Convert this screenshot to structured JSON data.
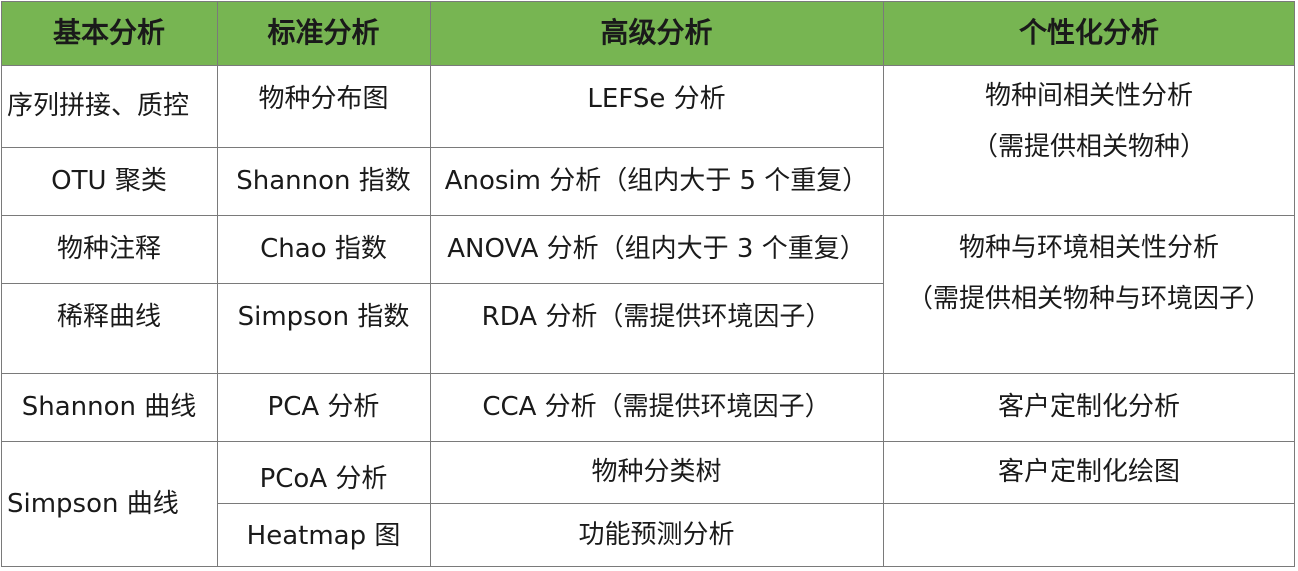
{
  "headers": [
    "基本分析",
    "标准分析",
    "高级分析",
    "个性化分析"
  ],
  "basic": [
    "序列拼接、质控",
    "OTU 聚类",
    "物种注释",
    "稀释曲线",
    "Shannon 曲线",
    "Simpson 曲线"
  ],
  "standard": [
    "物种分布图",
    "Shannon 指数",
    "Chao 指数",
    "Simpson 指数",
    "PCA 分析",
    "PCoA 分析",
    "Heatmap 图"
  ],
  "advanced": [
    "LEFSe 分析",
    "Anosim 分析（组内大于 5 个重复）",
    "ANOVA 分析（组内大于 3 个重复）",
    "RDA 分析（需提供环境因子）",
    "CCA 分析（需提供环境因子）",
    "物种分类树",
    "功能预测分析"
  ],
  "custom": [
    {
      "line1": "物种间相关性分析",
      "line2": "（需提供相关物种）"
    },
    {
      "line1": "物种与环境相关性分析",
      "line2": "（需提供相关物种与环境因子）"
    },
    {
      "line1": "客户定制化分析",
      "line2": ""
    },
    {
      "line1": "客户定制化绘图",
      "line2": ""
    },
    {
      "line1": "",
      "line2": ""
    }
  ],
  "colors": {
    "header_bg": "#77b552",
    "grid": "#7a7a7a"
  }
}
